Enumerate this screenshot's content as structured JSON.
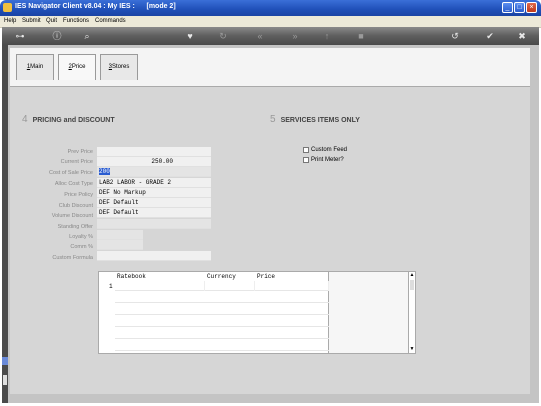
{
  "window": {
    "title": "IES Navigator Client v8.04 : My IES :      [mode 2]",
    "minimize_label": "_",
    "maximize_label": "□",
    "close_label": "×"
  },
  "menu": [
    "Help",
    "Submit",
    "Quit",
    "Functions",
    "Commands"
  ],
  "toolbar_icons": [
    "key-icon",
    "info-icon",
    "search-icon",
    "heart-icon",
    "refresh-icon",
    "back-icon",
    "forward-icon",
    "up-icon",
    "stop-icon",
    "undo-icon",
    "ok-icon",
    "close-icon"
  ],
  "tabs": [
    {
      "key": "1",
      "label": "Main"
    },
    {
      "key": "2",
      "label": "Price"
    },
    {
      "key": "3",
      "label": "Stores"
    }
  ],
  "pricing": {
    "number": "4",
    "title": "PRICING and DISCOUNT",
    "fields": [
      {
        "label": "Prev Price",
        "value": ""
      },
      {
        "label": "Current Price",
        "value": "250.00"
      },
      {
        "label": "Cost of Sale Price",
        "value": "200"
      },
      {
        "label": "Alloc Cost Type",
        "value": "LAB2 LABOR - GRADE 2"
      },
      {
        "label": "Price Policy",
        "value": "DEF No Markup"
      },
      {
        "label": "Club Discount",
        "value": "DEF Default"
      },
      {
        "label": "Volume Discount",
        "value": "DEF Default"
      },
      {
        "label": "Standing Offer",
        "value": ""
      },
      {
        "label": "Loyalty %",
        "value": ""
      },
      {
        "label": "Comm %",
        "value": ""
      },
      {
        "label": "Custom Formula",
        "value": ""
      }
    ]
  },
  "services": {
    "number": "5",
    "title": "SERVICES ITEMS ONLY",
    "checkboxes": [
      {
        "label": "Custom Feed",
        "checked": false
      },
      {
        "label": "Print Meter?",
        "checked": false
      }
    ]
  },
  "ratebook": {
    "columns": [
      "Ratebook",
      "Currency",
      "Price"
    ],
    "rows": [
      {
        "num": "1",
        "ratebook": "",
        "currency": "",
        "price": ""
      }
    ],
    "scroll_up": "▲",
    "scroll_down": "▼"
  }
}
